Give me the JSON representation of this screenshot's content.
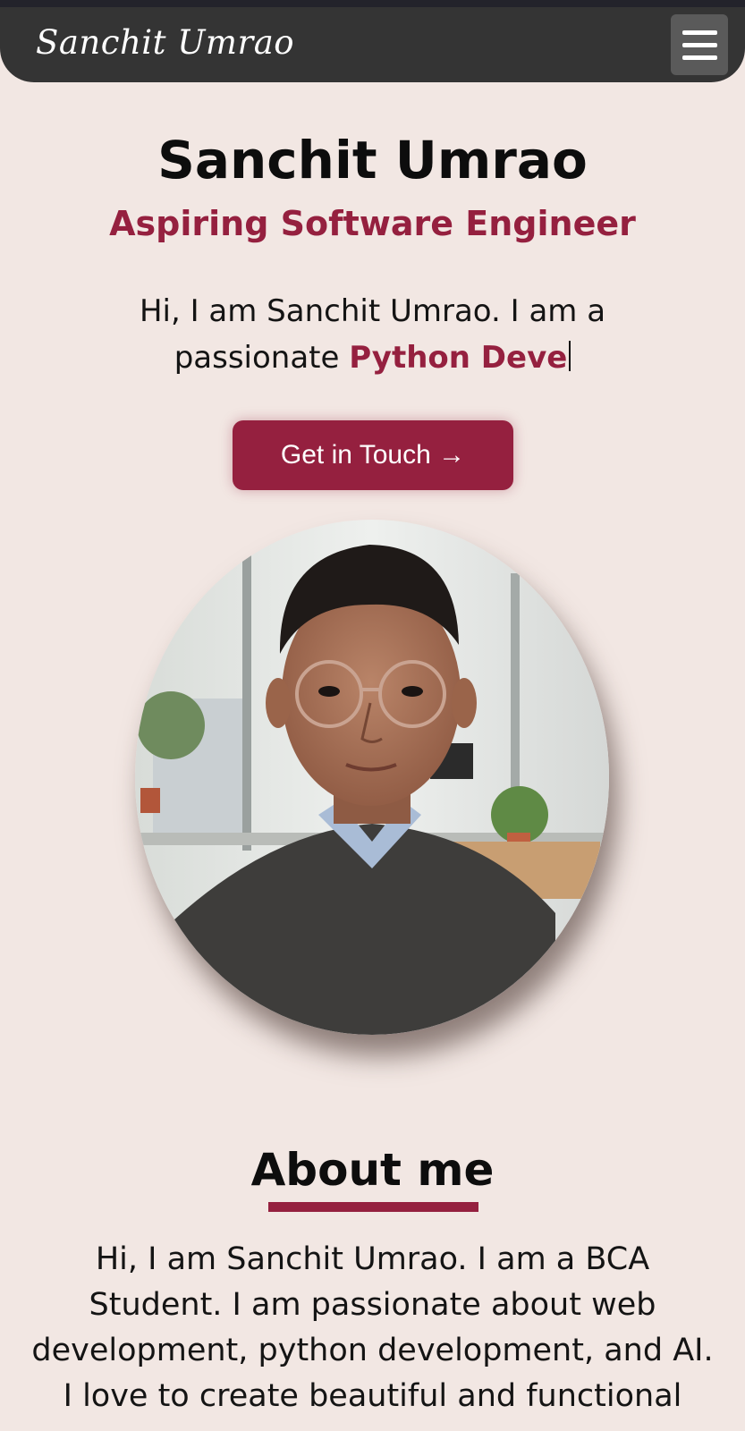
{
  "header": {
    "brand": "Sanchit Umrao",
    "menu_icon": "hamburger-menu-icon"
  },
  "hero": {
    "name": "Sanchit Umrao",
    "role": "Aspiring Software Engineer",
    "intro_prefix": "Hi, I am Sanchit Umrao. I am a passionate ",
    "typed_text": "Python Deve",
    "cta_label": "Get in Touch →"
  },
  "about": {
    "title": "About me",
    "text": "Hi, I am Sanchit Umrao. I am a BCA Student. I am passionate about web development, python development, and AI. I love to create beautiful and functional"
  },
  "colors": {
    "accent": "#95203f",
    "background": "#f2e7e3",
    "navbar": "#343434"
  }
}
